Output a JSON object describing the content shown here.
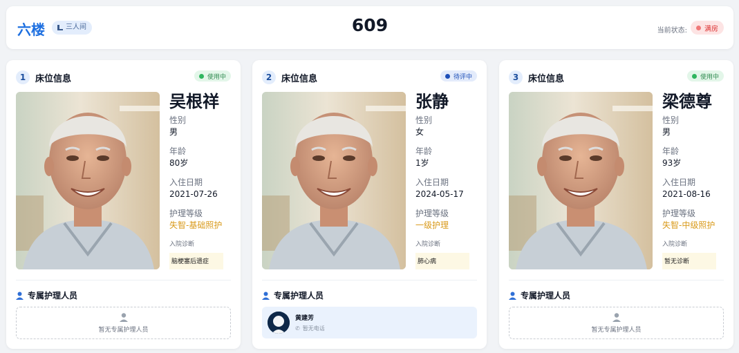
{
  "header": {
    "floor": "六楼",
    "room_type": "三人间",
    "room_number": "609",
    "status_label": "当前状态:",
    "status": "满房",
    "status_color": "#e04848"
  },
  "beds": [
    {
      "number": "1",
      "title": "床位信息",
      "status": "使用中",
      "status_color": "#2fb55e",
      "name": "吴根祥",
      "gender_label": "性别",
      "gender": "男",
      "age_label": "年龄",
      "age": "80岁",
      "checkin_label": "入住日期",
      "checkin": "2021-07-26",
      "care_label": "护理等级",
      "care": "失智-基础照护",
      "diagnosis_label": "入院诊断",
      "diagnosis": "脑梗塞后遗症",
      "nurse_title": "专属护理人员",
      "nurse_empty": "暂无专属护理人员"
    },
    {
      "number": "2",
      "title": "床位信息",
      "status": "待评中",
      "status_color": "#1d4fb8",
      "name": "张静",
      "gender_label": "性别",
      "gender": "女",
      "age_label": "年龄",
      "age": "1岁",
      "checkin_label": "入住日期",
      "checkin": "2024-05-17",
      "care_label": "护理等级",
      "care": "一级护理",
      "diagnosis_label": "入院诊断",
      "diagnosis": "肺心病",
      "nurse_title": "专属护理人员",
      "nurse_name": "黄建芳",
      "nurse_phone": "暂无电话"
    },
    {
      "number": "3",
      "title": "床位信息",
      "status": "使用中",
      "status_color": "#2fb55e",
      "name": "梁德尊",
      "gender_label": "性别",
      "gender": "男",
      "age_label": "年龄",
      "age": "93岁",
      "checkin_label": "入住日期",
      "checkin": "2021-08-16",
      "care_label": "护理等级",
      "care": "失智-中级照护",
      "diagnosis_label": "入院诊断",
      "diagnosis": "暂无诊断",
      "nurse_title": "专属护理人员",
      "nurse_empty": "暂无专属护理人员"
    }
  ]
}
